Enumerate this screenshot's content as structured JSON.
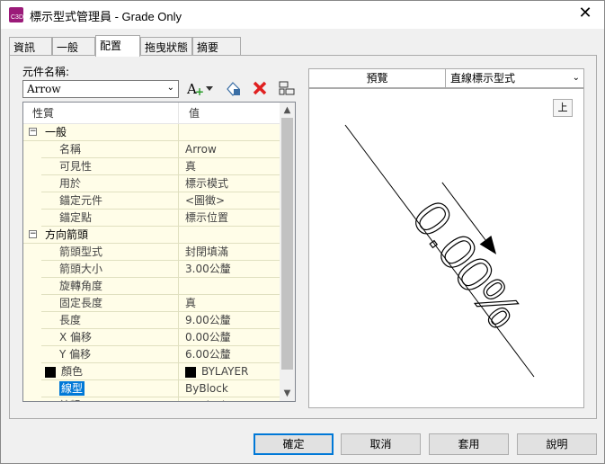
{
  "window": {
    "title": "標示型式管理員 - Grade Only",
    "icon_label": "C3D"
  },
  "tabs": [
    {
      "label": "資訊"
    },
    {
      "label": "一般"
    },
    {
      "label": "配置"
    },
    {
      "label": "拖曳狀態"
    },
    {
      "label": "摘要"
    }
  ],
  "component": {
    "label": "元件名稱:",
    "value": "Arrow"
  },
  "grid": {
    "headers": {
      "property": "性質",
      "value": "值"
    },
    "rows": [
      {
        "cat": true,
        "label": "一般",
        "value": ""
      },
      {
        "label": "名稱",
        "value": "Arrow"
      },
      {
        "label": "可見性",
        "value": "真"
      },
      {
        "label": "用於",
        "value": "標示模式"
      },
      {
        "label": "錨定元件",
        "value": "<圖徵>"
      },
      {
        "label": "錨定點",
        "value": "標示位置"
      },
      {
        "cat": true,
        "label": "方向箭頭",
        "value": ""
      },
      {
        "label": "箭頭型式",
        "value": "封閉填滿"
      },
      {
        "label": "箭頭大小",
        "value": "3.00公釐"
      },
      {
        "label": "旋轉角度",
        "value": ""
      },
      {
        "label": "固定長度",
        "value": "真"
      },
      {
        "label": "長度",
        "value": "9.00公釐"
      },
      {
        "label": "X 偏移",
        "value": "0.00公釐"
      },
      {
        "label": "Y 偏移",
        "value": "6.00公釐"
      },
      {
        "label": "顏色",
        "value": "BYLAYER",
        "swatch": true
      },
      {
        "label": "線型",
        "value": "ByBlock",
        "selected": true
      },
      {
        "label": "線粗",
        "value": "ByBlock"
      }
    ]
  },
  "preview": {
    "label": "預覽",
    "type": "直線標示型式",
    "up_button": "上",
    "grade_text": "0.00%"
  },
  "buttons": {
    "ok": "確定",
    "cancel": "取消",
    "apply": "套用",
    "help": "說明"
  },
  "colors": {
    "accent": "#0078d7",
    "grid_bg": "#fffde8",
    "icon_bg": "#9b1a79"
  }
}
